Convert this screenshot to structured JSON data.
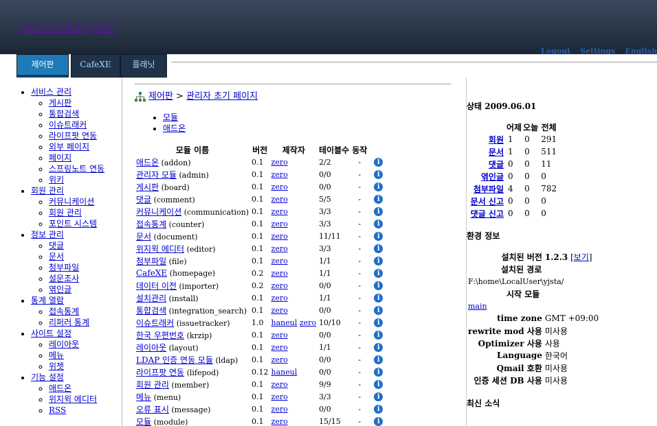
{
  "header": {
    "logo": "XpressEngine",
    "links": [
      "Logout",
      "Settings",
      "English"
    ]
  },
  "tabs": [
    {
      "label": "제어판",
      "active": true
    },
    {
      "label": "CafeXE",
      "active": false
    },
    {
      "label": "플래닛",
      "active": false
    }
  ],
  "sidebar": [
    {
      "label": "서비스 관리",
      "items": [
        "게시판",
        "통합검색",
        "이슈트래커",
        "라이프팟 연동",
        "외부 페이지",
        "페이지",
        "스프링노트 연동",
        "위키"
      ]
    },
    {
      "label": "회원 관리",
      "items": [
        "커뮤니케이션",
        "회원 관리",
        "포인트 시스템"
      ]
    },
    {
      "label": "정보 관리",
      "items": [
        "댓글",
        "문서",
        "첨부파일",
        "설문조사",
        "엮인글"
      ]
    },
    {
      "label": "통계 열람",
      "items": [
        "접속통계",
        "리퍼러 통계"
      ]
    },
    {
      "label": "사이트 설정",
      "items": [
        "레이아웃",
        "메뉴",
        "위젯"
      ]
    },
    {
      "label": "기능 설정",
      "items": [
        "애드온",
        "위지윅 에디터",
        "RSS"
      ]
    }
  ],
  "breadcrumb": {
    "home": "제어판",
    "separator": ">",
    "current": "관리자 초기 페이지"
  },
  "submenu": [
    "모듈",
    "애드온"
  ],
  "module_table": {
    "headers": [
      "모듈 이름",
      "버전",
      "제작자",
      "테이블수",
      "동작"
    ],
    "rows": [
      {
        "name": "애드온",
        "id": "(addon)",
        "version": "0.1",
        "authors": [
          "zero"
        ],
        "tables": "2/2",
        "action": "-"
      },
      {
        "name": "관리자 모듈",
        "id": "(admin)",
        "version": "0.1",
        "authors": [
          "zero"
        ],
        "tables": "0/0",
        "action": "-"
      },
      {
        "name": "게시판",
        "id": "(board)",
        "version": "0.1",
        "authors": [
          "zero"
        ],
        "tables": "0/0",
        "action": "-"
      },
      {
        "name": "댓글",
        "id": "(comment)",
        "version": "0.1",
        "authors": [
          "zero"
        ],
        "tables": "5/5",
        "action": "-"
      },
      {
        "name": "커뮤니케이션",
        "id": "(communication)",
        "version": "0.1",
        "authors": [
          "zero"
        ],
        "tables": "3/3",
        "action": "-"
      },
      {
        "name": "접속통계",
        "id": "(counter)",
        "version": "0.1",
        "authors": [
          "zero"
        ],
        "tables": "3/3",
        "action": "-"
      },
      {
        "name": "문서",
        "id": "(document)",
        "version": "0.1",
        "authors": [
          "zero"
        ],
        "tables": "11/11",
        "action": "-"
      },
      {
        "name": "위지윅 에디터",
        "id": "(editor)",
        "version": "0.1",
        "authors": [
          "zero"
        ],
        "tables": "3/3",
        "action": "-"
      },
      {
        "name": "첨부파일",
        "id": "(file)",
        "version": "0.1",
        "authors": [
          "zero"
        ],
        "tables": "1/1",
        "action": "-"
      },
      {
        "name": "CafeXE",
        "id": "(homepage)",
        "version": "0.2",
        "authors": [
          "zero"
        ],
        "tables": "1/1",
        "action": "-"
      },
      {
        "name": "데이터 이전",
        "id": "(importer)",
        "version": "0.2",
        "authors": [
          "zero"
        ],
        "tables": "0/0",
        "action": "-"
      },
      {
        "name": "설치관리",
        "id": "(install)",
        "version": "0.1",
        "authors": [
          "zero"
        ],
        "tables": "1/1",
        "action": "-"
      },
      {
        "name": "통합검색",
        "id": "(integration_search)",
        "version": "0.1",
        "authors": [
          "zero"
        ],
        "tables": "0/0",
        "action": "-"
      },
      {
        "name": "이슈트래커",
        "id": "(issuetracker)",
        "version": "1.0",
        "authors": [
          "haneul",
          "zero"
        ],
        "tables": "10/10",
        "action": "-"
      },
      {
        "name": "한국 우편번호",
        "id": "(krzip)",
        "version": "0.1",
        "authors": [
          "zero"
        ],
        "tables": "0/0",
        "action": "-"
      },
      {
        "name": "레이아웃",
        "id": "(layout)",
        "version": "0.1",
        "authors": [
          "zero"
        ],
        "tables": "1/1",
        "action": "-"
      },
      {
        "name": "LDAP 인증 연동 모듈",
        "id": "(ldap)",
        "version": "0.1",
        "authors": [
          "zero"
        ],
        "tables": "0/0",
        "action": "-"
      },
      {
        "name": "라이프팟 연동",
        "id": "(lifepod)",
        "version": "0.12",
        "authors": [
          "haneul"
        ],
        "tables": "0/0",
        "action": "-"
      },
      {
        "name": "회원 관리",
        "id": "(member)",
        "version": "0.1",
        "authors": [
          "zero"
        ],
        "tables": "9/9",
        "action": "-"
      },
      {
        "name": "메뉴",
        "id": "(menu)",
        "version": "0.1",
        "authors": [
          "zero"
        ],
        "tables": "3/3",
        "action": "-"
      },
      {
        "name": "오류 표시",
        "id": "(message)",
        "version": "0.1",
        "authors": [
          "zero"
        ],
        "tables": "0/0",
        "action": "-"
      },
      {
        "name": "모듈",
        "id": "(module)",
        "version": "0.1",
        "authors": [
          "zero"
        ],
        "tables": "15/15",
        "action": "-"
      }
    ]
  },
  "status": {
    "title": "상태 2009.06.01",
    "headers": [
      "어제",
      "오늘",
      "전체"
    ],
    "rows": [
      {
        "label": "회원",
        "values": [
          "1",
          "0",
          "291"
        ]
      },
      {
        "label": "문서",
        "values": [
          "1",
          "0",
          "511"
        ]
      },
      {
        "label": "댓글",
        "values": [
          "0",
          "0",
          "11"
        ]
      },
      {
        "label": "엮인글",
        "values": [
          "0",
          "0",
          "0"
        ]
      },
      {
        "label": "첨부파일",
        "values": [
          "4",
          "0",
          "782"
        ]
      },
      {
        "label": "문서 신고",
        "values": [
          "0",
          "0",
          "0"
        ]
      },
      {
        "label": "댓글 신고",
        "values": [
          "0",
          "0",
          "0"
        ]
      }
    ]
  },
  "env": {
    "title": "환경 정보",
    "installed_version_label": "설치된 버전",
    "installed_version": "1.2.3",
    "view_link": "보기",
    "install_path_label": "설치된 경로",
    "install_path": "F:\\home\\LocalUser\\yjsta/",
    "start_module_label": "시작 모듈",
    "start_module": "main",
    "settings": [
      {
        "key": "time zone",
        "value": "GMT +09:00"
      },
      {
        "key": "rewrite mod 사용",
        "value": "미사용"
      },
      {
        "key": "Optimizer 사용",
        "value": "사용"
      },
      {
        "key": "Language",
        "value": "한국어"
      },
      {
        "key": "Qmail 호환",
        "value": "미사용"
      },
      {
        "key": "인증 세션 DB 사용",
        "value": "미사용"
      }
    ]
  },
  "news": {
    "title": "최신 소식"
  }
}
